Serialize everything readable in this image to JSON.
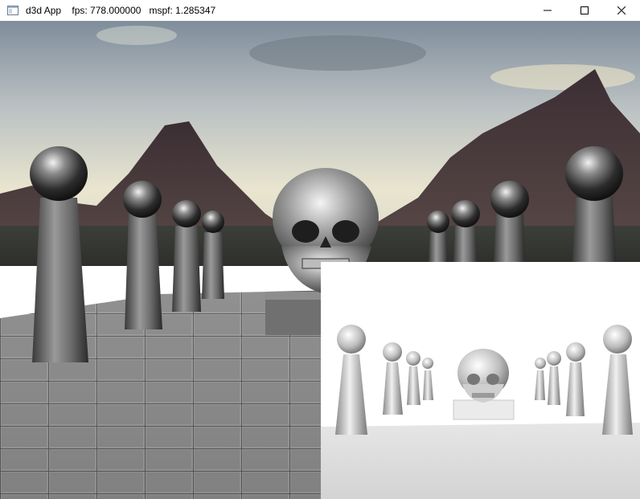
{
  "window": {
    "title": "d3d App    fps: 778.000000   mspf: 1.285347",
    "icon": "app-window-icon",
    "controls": {
      "minimize_icon": "minimize-icon",
      "maximize_icon": "maximize-icon",
      "close_icon": "close-icon"
    }
  },
  "scene": {
    "main_view": "skull-on-pedestal-with-pillars-and-mirror-spheres",
    "inset_view": "ambient-occlusion-debug-view",
    "colors": {
      "sky_top": "#8d9aa6",
      "sky_horizon": "#e8e4d0",
      "mountain": "#4a3a3e",
      "floor": "#8a8a8a",
      "inset_bg": "#ffffff"
    }
  }
}
